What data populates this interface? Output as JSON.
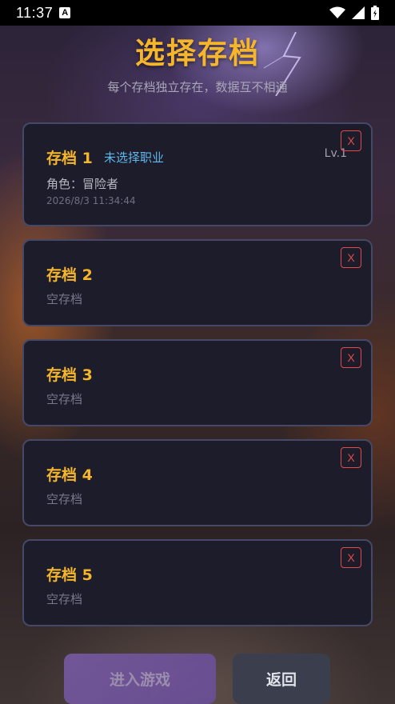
{
  "status_bar": {
    "time": "11:37",
    "a_badge": "A",
    "icons": [
      "wifi-icon",
      "signal-icon",
      "battery-icon"
    ]
  },
  "title": "选择存档",
  "subtitle": "每个存档独立存在，数据互不相通",
  "slots": [
    {
      "name": "存档 1",
      "job": "未选择职业",
      "level": "Lv.1",
      "role": "角色：冒险者",
      "timestamp": "2026/8/3 11:34:44",
      "delete_label": "X"
    },
    {
      "name": "存档 2",
      "empty_text": "空存档",
      "delete_label": "X"
    },
    {
      "name": "存档 3",
      "empty_text": "空存档",
      "delete_label": "X"
    },
    {
      "name": "存档 4",
      "empty_text": "空存档",
      "delete_label": "X"
    },
    {
      "name": "存档 5",
      "empty_text": "空存档",
      "delete_label": "X"
    }
  ],
  "buttons": {
    "enter": "进入游戏",
    "back": "返回"
  },
  "colors": {
    "accent": "#f6b62c",
    "job_text": "#5fb7ec",
    "delete": "#e34b4b",
    "card_bg": "#1c1c2a",
    "card_border": "#464867"
  }
}
